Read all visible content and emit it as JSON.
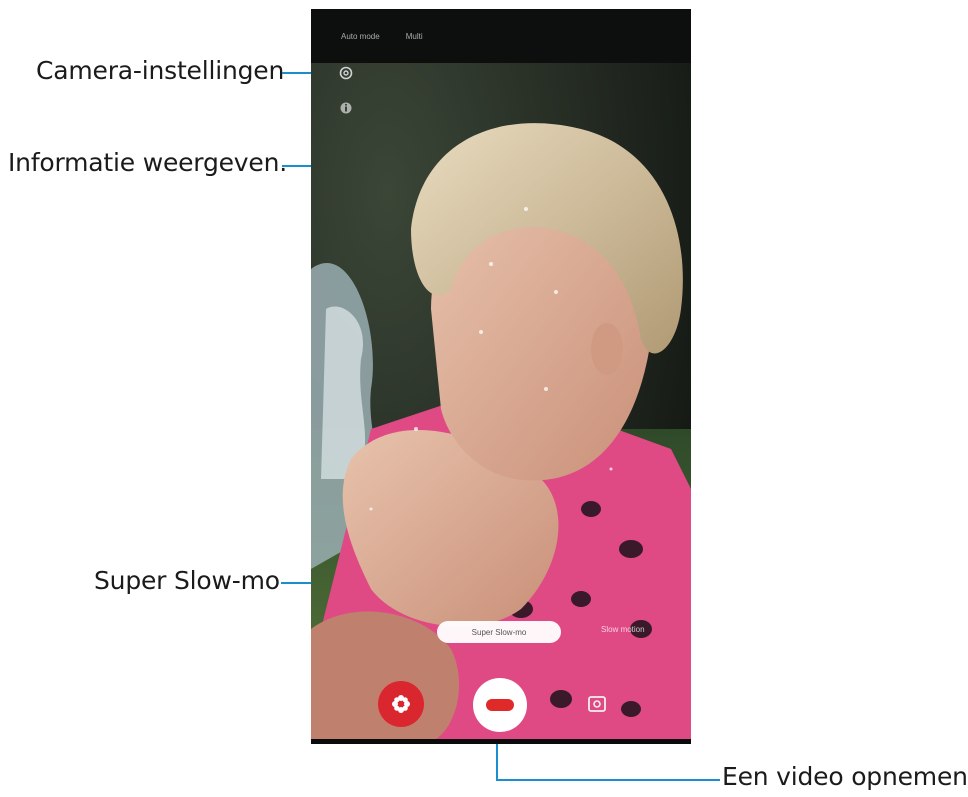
{
  "callouts": {
    "camera_settings": "Camera-instellingen",
    "show_info": "Informatie weergeven.",
    "super_slow_mo": "Super Slow-mo",
    "record_video": "Een video opnemen."
  },
  "camera": {
    "top_modes": [
      "Auto mode",
      "Multi"
    ],
    "mode_pill": "Super Slow-mo",
    "mode_right": "Slow motion"
  },
  "colors": {
    "leader_line": "#1a8fd0",
    "effect_button": "#d9262f",
    "record_dot": "#e02a2a"
  },
  "icons": {
    "settings": "gear-icon",
    "info": "info-icon",
    "effect": "flower-icon",
    "record": "record-video-icon",
    "switch_camera": "switch-camera-icon"
  }
}
